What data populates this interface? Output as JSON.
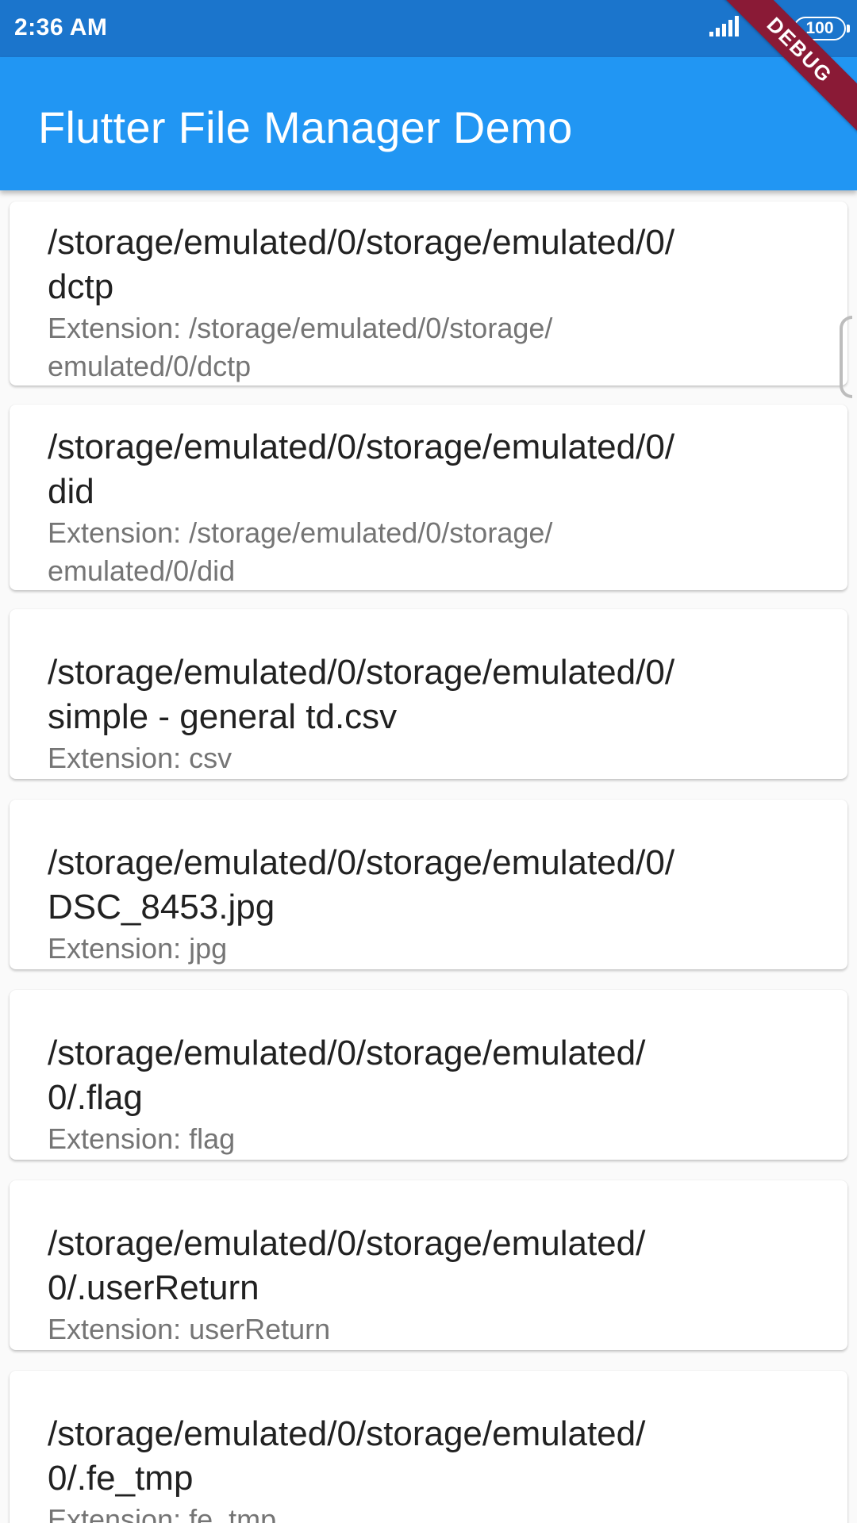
{
  "status_bar": {
    "time": "2:36 AM",
    "battery": "100",
    "icons": [
      "signal-icon",
      "wifi-icon",
      "battery-icon"
    ]
  },
  "app_bar": {
    "title": "Flutter File Manager Demo",
    "color": "#2196f3"
  },
  "debug_banner": "DEBUG",
  "files": [
    {
      "line1": "/storage/emulated/0/storage/emulated/0/",
      "line2": "dctp",
      "ext1": "Extension: /storage/emulated/0/storage/",
      "ext2": "emulated/0/dctp"
    },
    {
      "line1": "/storage/emulated/0/storage/emulated/0/",
      "line2": "did",
      "ext1": "Extension: /storage/emulated/0/storage/",
      "ext2": "emulated/0/did"
    },
    {
      "line1": "/storage/emulated/0/storage/emulated/0/",
      "line2": "simple - general td.csv",
      "ext1": "Extension: csv",
      "ext2": ""
    },
    {
      "line1": "/storage/emulated/0/storage/emulated/0/",
      "line2": "DSC_8453.jpg",
      "ext1": "Extension: jpg",
      "ext2": ""
    },
    {
      "line1": "/storage/emulated/0/storage/emulated/",
      "line2": "0/.flag",
      "ext1": "Extension: flag",
      "ext2": ""
    },
    {
      "line1": "/storage/emulated/0/storage/emulated/",
      "line2": "0/.userReturn",
      "ext1": "Extension: userReturn",
      "ext2": ""
    },
    {
      "line1": "/storage/emulated/0/storage/emulated/",
      "line2": "0/.fe_tmp",
      "ext1": "Extension: fe_tmp",
      "ext2": ""
    }
  ]
}
